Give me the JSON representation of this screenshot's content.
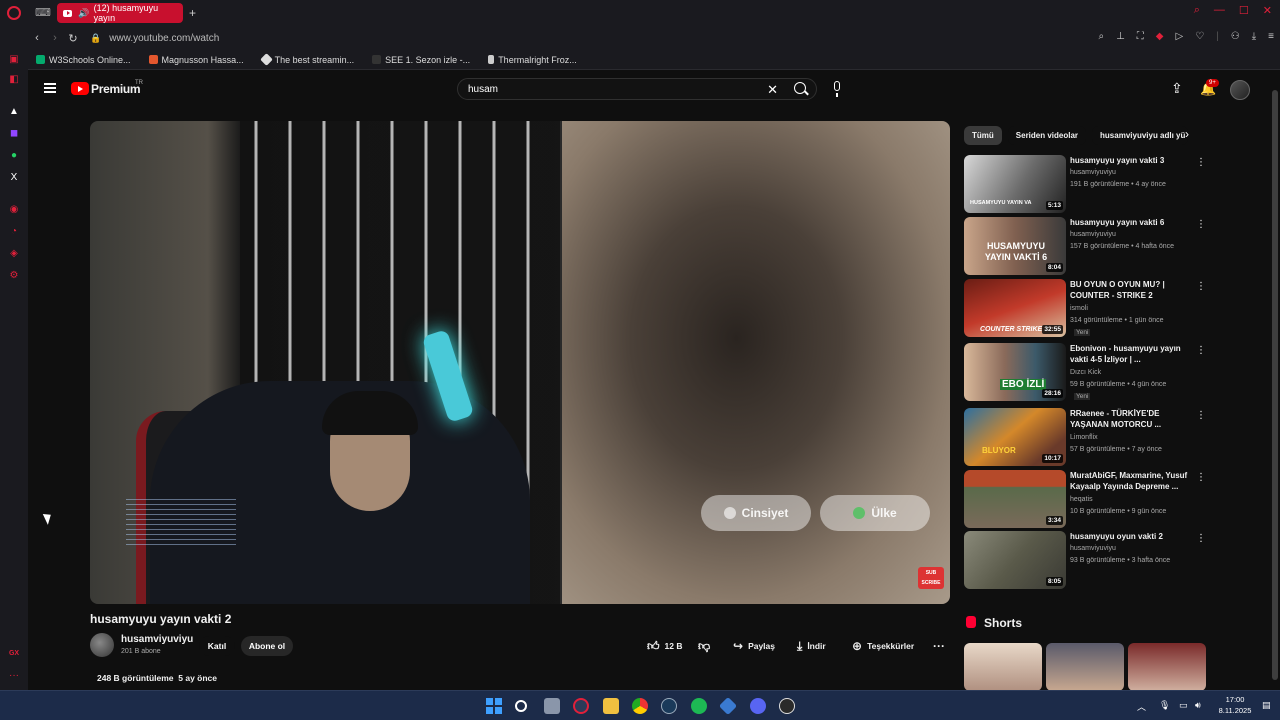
{
  "browser": {
    "tab_title": "(12) husamyuyu yayın",
    "url": "www.youtube.com/watch",
    "bookmarks": [
      "W3Schools Online...",
      "Magnusson Hassa...",
      "The best streamin...",
      "SEE 1. Sezon izle -...",
      "Thermalright Froz..."
    ]
  },
  "yt_header": {
    "logo_text": "Premium",
    "region": "TR",
    "search_value": "husam",
    "notifications": "9+"
  },
  "video": {
    "title": "husamyuyu yayın vakti 2",
    "pill_gender": "Cinsiyet",
    "pill_country": "Ülke",
    "subscribe_badge": "SUB SCRIBE"
  },
  "channel": {
    "name": "husamviyuviyu",
    "subscribers": "201 B abone",
    "join_label": "Katıl",
    "subscribe_label": "Abone ol"
  },
  "actions": {
    "likes": "12 B",
    "share": "Paylaş",
    "download": "İndir",
    "thanks": "Teşekkürler"
  },
  "meta": {
    "views": "248 B görüntüleme",
    "age": "5 ay önce"
  },
  "chips": [
    "Tümü",
    "Seriden videolar",
    "husamviyuviyu adlı yü"
  ],
  "recommendations": [
    {
      "title": "husamyuyu yayın vakti 3",
      "channel": "husamviyuviyu",
      "meta": "191 B görüntüleme • 4 ay önce",
      "duration": "5:13",
      "thumb_text": "HUSAMYUYU YAYIN VA",
      "new": ""
    },
    {
      "title": "husamyuyu yayın vakti 6",
      "channel": "husamviyuviyu",
      "meta": "157 B görüntüleme • 4 hafta önce",
      "duration": "8:04",
      "thumb_text": "HUSAMYUYU YAYIN VAKTİ 6",
      "new": ""
    },
    {
      "title": "BU OYUN O OYUN MU? | COUNTER - STRIKE 2",
      "channel": "ismoli",
      "meta": "314 görüntüleme • 1 gün önce",
      "duration": "32:55",
      "thumb_text": "COUNTER STRIKE 2",
      "new": "Yeni"
    },
    {
      "title": "Ebonivon - husamyuyu yayın vakti 4-5 İzliyor | ...",
      "channel": "Dızcı Kick",
      "meta": "59 B görüntüleme • 4 gün önce",
      "duration": "28:16",
      "thumb_text": "EBO İZLİ",
      "new": "Yeni"
    },
    {
      "title": "RRaenee - TÜRKİYE'DE YAŞANAN MOTORCU ...",
      "channel": "Limonflix",
      "meta": "57 B görüntüleme • 7 ay önce",
      "duration": "10:17",
      "thumb_text": "BLUYOR",
      "new": ""
    },
    {
      "title": "MuratAbiGF, Maxmarine, Yusuf Kayaalp Yayında Depreme ...",
      "channel": "heqatis",
      "meta": "10 B görüntüleme • 9 gün önce",
      "duration": "3:34",
      "thumb_text": "",
      "new": ""
    },
    {
      "title": "husamyuyu oyun vakti 2",
      "channel": "husamviyuviyu",
      "meta": "93 B görüntüleme • 3 hafta önce",
      "duration": "8:05",
      "thumb_text": "",
      "new": ""
    }
  ],
  "shorts": {
    "title": "Shorts"
  },
  "clock": {
    "time": "17:00",
    "date": "8.11.2025"
  },
  "colors": {
    "accent": "#ff0000",
    "opera_red": "#e0203a",
    "bg": "#0f0f0f",
    "taskbar": "#1c2b49"
  }
}
